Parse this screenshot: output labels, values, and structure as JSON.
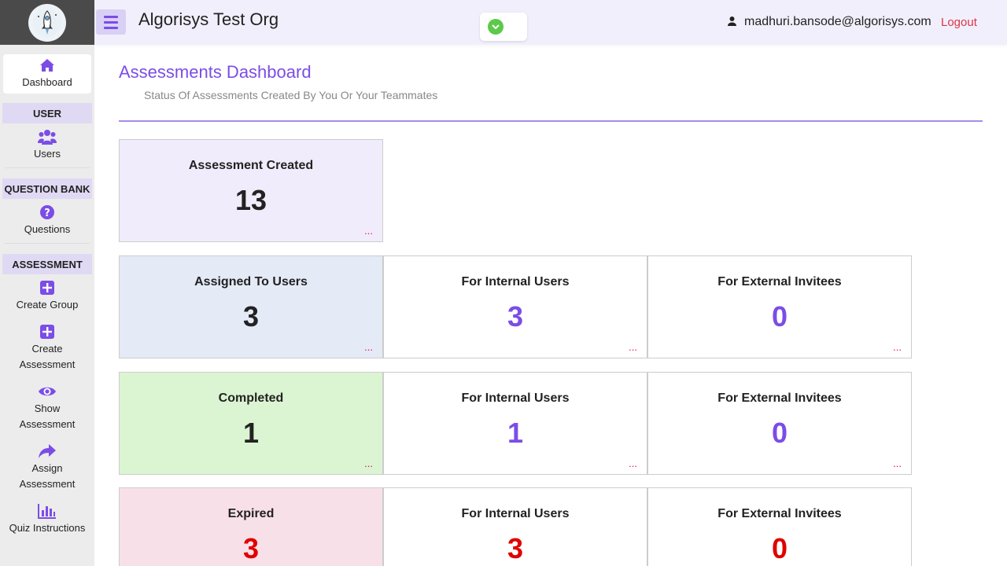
{
  "header": {
    "org_title": "Algorisys Test Org",
    "user_email": "madhuri.bansode@algorisys.com",
    "logout_label": "Logout"
  },
  "sidebar": {
    "dashboard": "Dashboard",
    "section_user": "USER",
    "users": "Users",
    "section_qb": "QUESTION BANK",
    "questions": "Questions",
    "section_assessment": "ASSESSMENT",
    "create_group": "Create Group",
    "create_assessment_1": "Create",
    "create_assessment_2": "Assessment",
    "show_assessment_1": "Show",
    "show_assessment_2": "Assessment",
    "assign_assessment_1": "Assign",
    "assign_assessment_2": "Assessment",
    "quiz_instructions": "Quiz Instructions"
  },
  "main": {
    "title": "Assessments Dashboard",
    "subtitle": "Status Of Assessments Created By You Or Your Teammates",
    "more": "...",
    "created": {
      "title": "Assessment Created",
      "value": "13"
    },
    "assigned": {
      "total": {
        "title": "Assigned To Users",
        "value": "3"
      },
      "internal": {
        "title": "For Internal Users",
        "value": "3"
      },
      "external": {
        "title": "For External Invitees",
        "value": "0"
      }
    },
    "completed": {
      "total": {
        "title": "Completed",
        "value": "1"
      },
      "internal": {
        "title": "For Internal Users",
        "value": "1"
      },
      "external": {
        "title": "For External Invitees",
        "value": "0"
      }
    },
    "expired": {
      "total": {
        "title": "Expired",
        "value": "3"
      },
      "internal": {
        "title": "For Internal Users",
        "value": "3"
      },
      "external": {
        "title": "For External Invitees",
        "value": "0"
      }
    }
  },
  "colors": {
    "accent": "#7b4de6",
    "danger": "#e00000",
    "logout": "#dc3545"
  }
}
